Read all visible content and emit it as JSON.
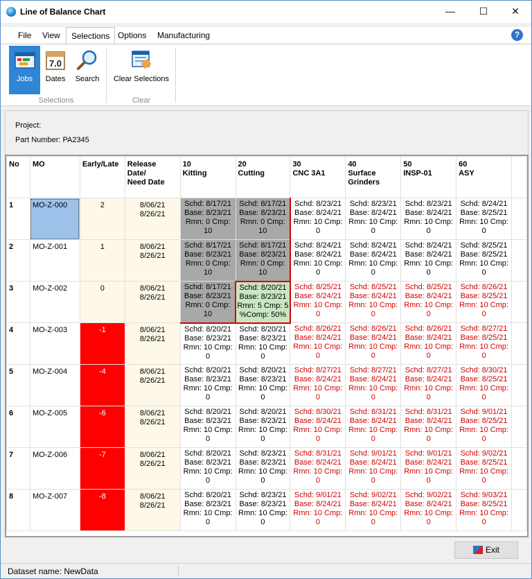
{
  "window": {
    "title": "Line of Balance Chart",
    "minimize": "—",
    "maximize": "☐",
    "close": "✕"
  },
  "menu": {
    "file": "File",
    "view": "View",
    "selections": "Selections",
    "options": "Options",
    "manufacturing": "Manufacturing",
    "help": "?"
  },
  "ribbon": {
    "jobs": "Jobs",
    "dates": "Dates",
    "dates_icon_text": "7.0",
    "search": "Search",
    "clear": "Clear Selections",
    "group_selections": "Selections",
    "group_clear": "Clear"
  },
  "info": {
    "project": "Project:",
    "part_number": "Part Number: PA2345"
  },
  "grid": {
    "headers": {
      "no": "No",
      "mo": "MO",
      "early_late": "Early/Late",
      "release": [
        "Release",
        "Date/",
        "Need Date"
      ],
      "ops": [
        [
          "10",
          "Kitting"
        ],
        [
          "20",
          "Cutting"
        ],
        [
          "30",
          "CNC 3A1"
        ],
        [
          "40",
          "Surface",
          "Grinders"
        ],
        [
          "50",
          "INSP-01"
        ],
        [
          "60",
          "ASY"
        ]
      ]
    },
    "rows": [
      {
        "no": "1",
        "mo": "MO-Z-000",
        "el": "2",
        "rel": "8/06/21",
        "need": "8/26/21",
        "ops": [
          [
            "Schd: 8/17/21",
            "Base: 8/23/21",
            "Rmn: 0 Cmp:",
            "10"
          ],
          [
            "Schd: 8/17/21",
            "Base: 8/23/21",
            "Rmn: 0 Cmp:",
            "10"
          ],
          [
            "Schd: 8/23/21",
            "Base: 8/24/21",
            "Rmn: 10 Cmp:",
            "0"
          ],
          [
            "Schd: 8/23/21",
            "Base: 8/24/21",
            "Rmn: 10 Cmp:",
            "0"
          ],
          [
            "Schd: 8/23/21",
            "Base: 8/24/21",
            "Rmn: 10 Cmp:",
            "0"
          ],
          [
            "Schd: 8/24/21",
            "Base: 8/25/21",
            "Rmn: 10 Cmp:",
            "0"
          ]
        ]
      },
      {
        "no": "2",
        "mo": "MO-Z-001",
        "el": "1",
        "rel": "8/06/21",
        "need": "8/26/21",
        "ops": [
          [
            "Schd: 8/17/21",
            "Base: 8/23/21",
            "Rmn: 0 Cmp:",
            "10"
          ],
          [
            "Schd: 8/17/21",
            "Base: 8/23/21",
            "Rmn: 0 Cmp:",
            "10"
          ],
          [
            "Schd: 8/24/21",
            "Base: 8/24/21",
            "Rmn: 10 Cmp:",
            "0"
          ],
          [
            "Schd: 8/24/21",
            "Base: 8/24/21",
            "Rmn: 10 Cmp:",
            "0"
          ],
          [
            "Schd: 8/24/21",
            "Base: 8/24/21",
            "Rmn: 10 Cmp:",
            "0"
          ],
          [
            "Schd: 8/25/21",
            "Base: 8/25/21",
            "Rmn: 10 Cmp:",
            "0"
          ]
        ]
      },
      {
        "no": "3",
        "mo": "MO-Z-002",
        "el": "0",
        "rel": "8/06/21",
        "need": "8/26/21",
        "ops": [
          [
            "Schd: 8/17/21",
            "Base: 8/23/21",
            "Rmn: 0 Cmp:",
            "10"
          ],
          [
            "Schd: 8/20/21",
            "Base: 8/23/21",
            "Rmn: 5 Cmp: 5",
            "%Comp: 50%"
          ],
          [
            "Schd: 8/25/21",
            "Base: 8/24/21",
            "Rmn: 10 Cmp:",
            "0"
          ],
          [
            "Schd: 8/25/21",
            "Base: 8/24/21",
            "Rmn: 10 Cmp:",
            "0"
          ],
          [
            "Schd: 8/25/21",
            "Base: 8/24/21",
            "Rmn: 10 Cmp:",
            "0"
          ],
          [
            "Schd: 8/26/21",
            "Base: 8/25/21",
            "Rmn: 10 Cmp:",
            "0"
          ]
        ]
      },
      {
        "no": "4",
        "mo": "MO-Z-003",
        "el": "-1",
        "rel": "8/06/21",
        "need": "8/26/21",
        "ops": [
          [
            "Schd: 8/20/21",
            "Base: 8/23/21",
            "Rmn: 10 Cmp:",
            "0"
          ],
          [
            "Schd: 8/20/21",
            "Base: 8/23/21",
            "Rmn: 10 Cmp:",
            "0"
          ],
          [
            "Schd: 8/26/21",
            "Base: 8/24/21",
            "Rmn: 10 Cmp:",
            "0"
          ],
          [
            "Schd: 8/26/21",
            "Base: 8/24/21",
            "Rmn: 10 Cmp:",
            "0"
          ],
          [
            "Schd: 8/26/21",
            "Base: 8/24/21",
            "Rmn: 10 Cmp:",
            "0"
          ],
          [
            "Schd: 8/27/21",
            "Base: 8/25/21",
            "Rmn: 10 Cmp:",
            "0"
          ]
        ]
      },
      {
        "no": "5",
        "mo": "MO-Z-004",
        "el": "-4",
        "rel": "8/06/21",
        "need": "8/26/21",
        "ops": [
          [
            "Schd: 8/20/21",
            "Base: 8/23/21",
            "Rmn: 10 Cmp:",
            "0"
          ],
          [
            "Schd: 8/20/21",
            "Base: 8/23/21",
            "Rmn: 10 Cmp:",
            "0"
          ],
          [
            "Schd: 8/27/21",
            "Base: 8/24/21",
            "Rmn: 10 Cmp:",
            "0"
          ],
          [
            "Schd: 8/27/21",
            "Base: 8/24/21",
            "Rmn: 10 Cmp:",
            "0"
          ],
          [
            "Schd: 8/27/21",
            "Base: 8/24/21",
            "Rmn: 10 Cmp:",
            "0"
          ],
          [
            "Schd: 8/30/21",
            "Base: 8/25/21",
            "Rmn: 10 Cmp:",
            "0"
          ]
        ]
      },
      {
        "no": "6",
        "mo": "MO-Z-005",
        "el": "-6",
        "rel": "8/06/21",
        "need": "8/26/21",
        "ops": [
          [
            "Schd: 8/20/21",
            "Base: 8/23/21",
            "Rmn: 10 Cmp:",
            "0"
          ],
          [
            "Schd: 8/20/21",
            "Base: 8/23/21",
            "Rmn: 10 Cmp:",
            "0"
          ],
          [
            "Schd: 8/30/21",
            "Base: 8/24/21",
            "Rmn: 10 Cmp:",
            "0"
          ],
          [
            "Schd: 8/31/21",
            "Base: 8/24/21",
            "Rmn: 10 Cmp:",
            "0"
          ],
          [
            "Schd: 8/31/21",
            "Base: 8/24/21",
            "Rmn: 10 Cmp:",
            "0"
          ],
          [
            "Schd: 9/01/21",
            "Base: 8/25/21",
            "Rmn: 10 Cmp:",
            "0"
          ]
        ]
      },
      {
        "no": "7",
        "mo": "MO-Z-006",
        "el": "-7",
        "rel": "8/06/21",
        "need": "8/26/21",
        "ops": [
          [
            "Schd: 8/20/21",
            "Base: 8/23/21",
            "Rmn: 10 Cmp:",
            "0"
          ],
          [
            "Schd: 8/23/21",
            "Base: 8/23/21",
            "Rmn: 10 Cmp:",
            "0"
          ],
          [
            "Schd: 8/31/21",
            "Base: 8/24/21",
            "Rmn: 10 Cmp:",
            "0"
          ],
          [
            "Schd: 9/01/21",
            "Base: 8/24/21",
            "Rmn: 10 Cmp:",
            "0"
          ],
          [
            "Schd: 9/01/21",
            "Base: 8/24/21",
            "Rmn: 10 Cmp:",
            "0"
          ],
          [
            "Schd: 9/02/21",
            "Base: 8/25/21",
            "Rmn: 10 Cmp:",
            "0"
          ]
        ]
      },
      {
        "no": "8",
        "mo": "MO-Z-007",
        "el": "-8",
        "rel": "8/06/21",
        "need": "8/26/21",
        "ops": [
          [
            "Schd: 8/20/21",
            "Base: 8/23/21",
            "Rmn: 10 Cmp:",
            "0"
          ],
          [
            "Schd: 8/23/21",
            "Base: 8/23/21",
            "Rmn: 10 Cmp:",
            "0"
          ],
          [
            "Schd: 9/01/21",
            "Base: 8/24/21",
            "Rmn: 10 Cmp:",
            "0"
          ],
          [
            "Schd: 9/02/21",
            "Base: 8/24/21",
            "Rmn: 10 Cmp:",
            "0"
          ],
          [
            "Schd: 9/02/21",
            "Base: 8/24/21",
            "Rmn: 10 Cmp:",
            "0"
          ],
          [
            "Schd: 9/03/21",
            "Base: 8/25/21",
            "Rmn: 10 Cmp:",
            "0"
          ]
        ]
      }
    ]
  },
  "footer": {
    "exit": "Exit",
    "dataset_label": "Dataset name:  NewData"
  }
}
